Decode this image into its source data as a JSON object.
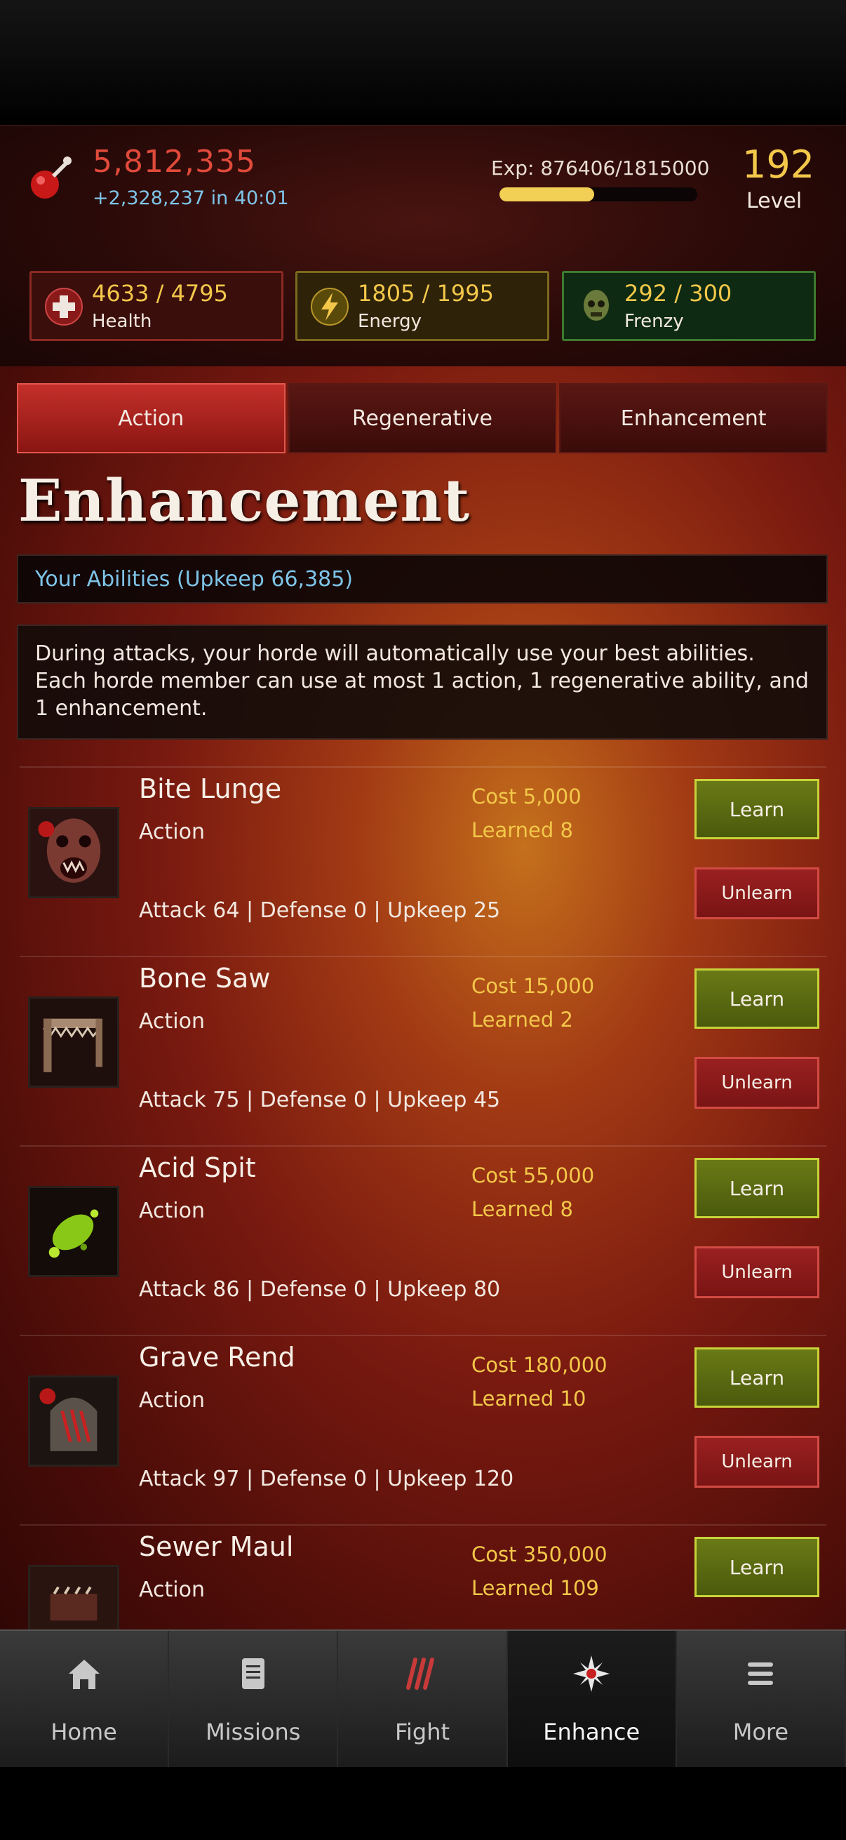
{
  "header": {
    "money": "5,812,335",
    "money_regen": "+2,328,237 in 40:01",
    "exp_label": "Exp: 876406/1815000",
    "exp_progress": 0.48,
    "level": "192",
    "level_label": "Level",
    "stats": [
      {
        "value": "4633 / 4795",
        "name": "Health",
        "icon": "health-cross-icon"
      },
      {
        "value": "1805 / 1995",
        "name": "Energy",
        "icon": "lightning-icon"
      },
      {
        "value": "292 / 300",
        "name": "Frenzy",
        "icon": "zombie-head-icon"
      }
    ]
  },
  "tabs": [
    "Action",
    "Regenerative",
    "Enhancement"
  ],
  "active_tab": "Action",
  "page_title": "Enhancement",
  "abilities_header": "Your Abilities (Upkeep 66,385)",
  "info_text": "During attacks, your horde will automatically use your best abilities. Each horde member can use at most 1 action, 1 regenerative ability, and 1 enhancement.",
  "abilities": [
    {
      "name": "Bite Lunge",
      "type": "Action",
      "cost": "Cost 5,000",
      "learned": "Learned 8",
      "stats": "Attack 64 | Defense 0 | Upkeep 25",
      "learn_label": "Learn",
      "unlearn_label": "Unlearn",
      "icon": "zombie-bite-icon"
    },
    {
      "name": "Bone Saw",
      "type": "Action",
      "cost": "Cost 15,000",
      "learned": "Learned 2",
      "stats": "Attack 75 | Defense 0 | Upkeep 45",
      "learn_label": "Learn",
      "unlearn_label": "Unlearn",
      "icon": "bone-saw-icon"
    },
    {
      "name": "Acid Spit",
      "type": "Action",
      "cost": "Cost 55,000",
      "learned": "Learned 8",
      "stats": "Attack 86 | Defense 0 | Upkeep 80",
      "learn_label": "Learn",
      "unlearn_label": "Unlearn",
      "icon": "acid-spit-icon"
    },
    {
      "name": "Grave Rend",
      "type": "Action",
      "cost": "Cost 180,000",
      "learned": "Learned 10",
      "stats": "Attack 97 | Defense 0 | Upkeep 120",
      "learn_label": "Learn",
      "unlearn_label": "Unlearn",
      "icon": "grave-rend-icon"
    },
    {
      "name": "Sewer Maul",
      "type": "Action",
      "cost": "Cost 350,000",
      "learned": "Learned 109",
      "stats": "",
      "learn_label": "Learn",
      "unlearn_label": "",
      "icon": "sewer-maul-icon"
    }
  ],
  "nav": [
    {
      "label": "Home",
      "icon": "home-icon"
    },
    {
      "label": "Missions",
      "icon": "document-icon"
    },
    {
      "label": "Fight",
      "icon": "claw-marks-icon"
    },
    {
      "label": "Enhance",
      "icon": "star-burst-icon"
    },
    {
      "label": "More",
      "icon": "menu-icon"
    }
  ],
  "active_nav": "Enhance",
  "colors": {
    "accent_red": "#e04a3a",
    "gold": "#f3c84a",
    "blue_text": "#7ec4e8",
    "learn_green": "#5a6a12",
    "unlearn_red": "#8a1a1a"
  }
}
